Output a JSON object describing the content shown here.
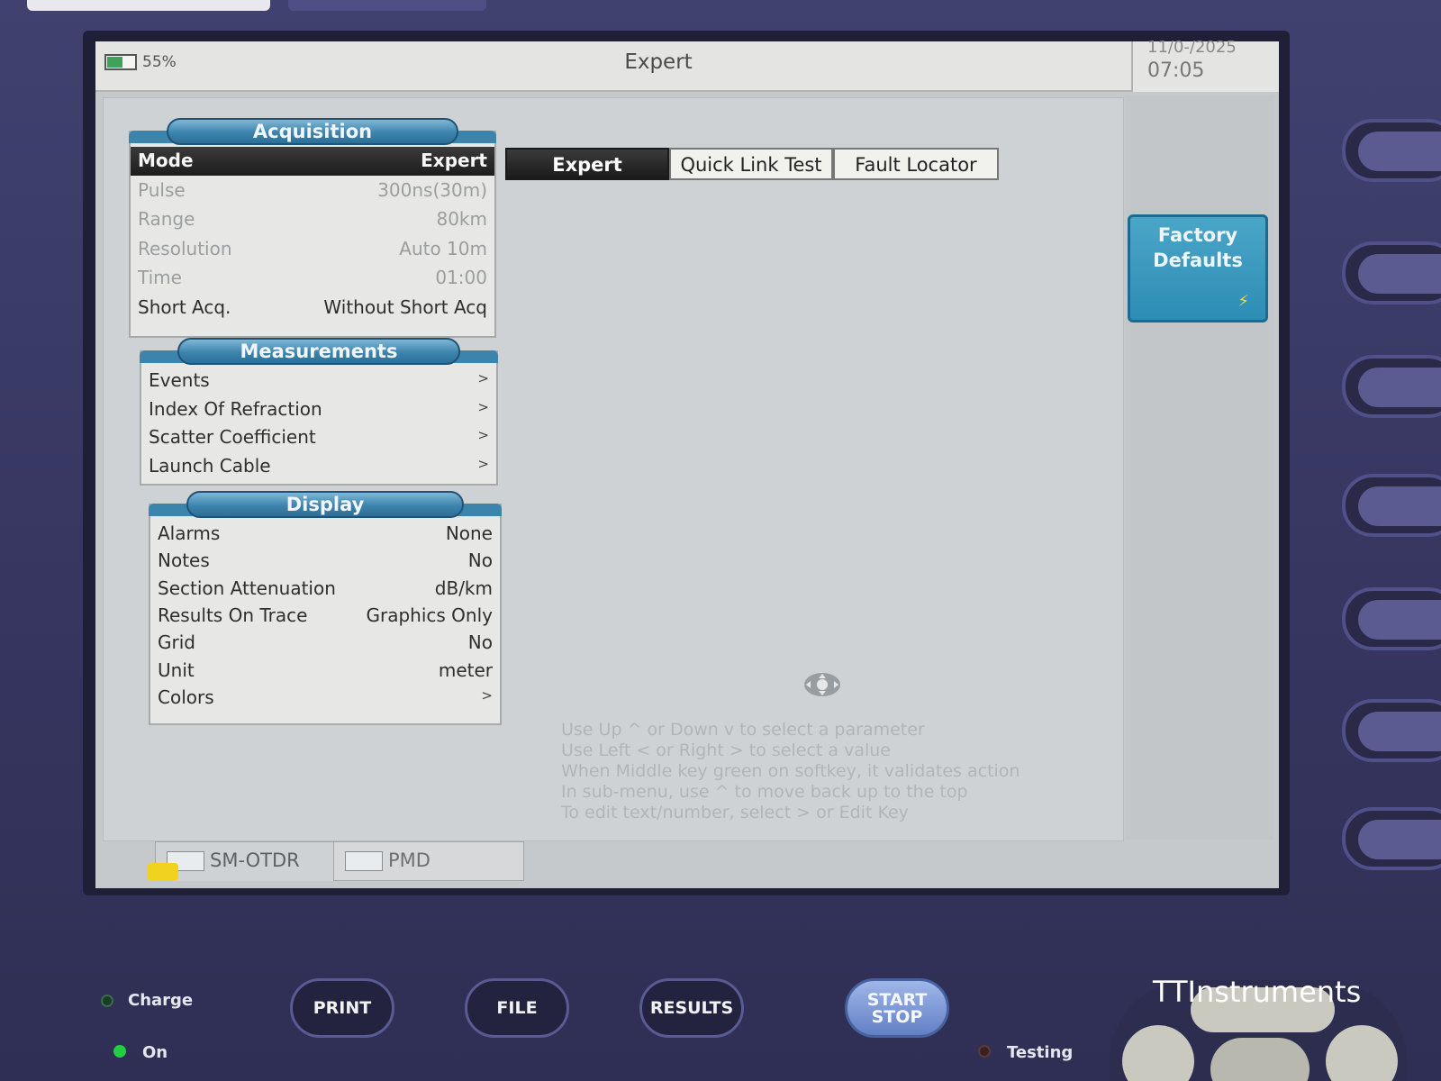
{
  "status_bar": {
    "battery_pct": "55%",
    "battery_level": 0.55,
    "title": "Expert",
    "date": "11/0-/2025",
    "time": "07:05"
  },
  "acquisition": {
    "header": "Acquisition",
    "rows": [
      {
        "label": "Mode",
        "value": "Expert",
        "state": "selected"
      },
      {
        "label": "Pulse",
        "value": "300ns(30m)",
        "state": "dim"
      },
      {
        "label": "Range",
        "value": "80km",
        "state": "dim"
      },
      {
        "label": "Resolution",
        "value": "Auto 10m",
        "state": "dim"
      },
      {
        "label": "Time",
        "value": "01:00",
        "state": "dim"
      },
      {
        "label": "Short Acq.",
        "value": "Without Short Acq",
        "state": "normal"
      }
    ]
  },
  "mode_options": [
    "Expert",
    "Quick Link Test",
    "Fault Locator"
  ],
  "measurements": {
    "header": "Measurements",
    "rows": [
      {
        "label": "Events",
        "value": ">"
      },
      {
        "label": "Index Of Refraction",
        "value": ">"
      },
      {
        "label": "Scatter Coefficient",
        "value": ">"
      },
      {
        "label": "Launch Cable",
        "value": ">"
      }
    ]
  },
  "display": {
    "header": "Display",
    "rows": [
      {
        "label": "Alarms",
        "value": "None"
      },
      {
        "label": "Notes",
        "value": "No"
      },
      {
        "label": "Section Attenuation",
        "value": "dB/km"
      },
      {
        "label": "Results On Trace",
        "value": "Graphics Only"
      },
      {
        "label": "Grid",
        "value": "No"
      },
      {
        "label": "Unit",
        "value": "meter"
      },
      {
        "label": "Colors",
        "value": ">"
      }
    ]
  },
  "help_lines": [
    "Use Up ^ or Down v to select a parameter",
    "Use Left < or Right > to select a value",
    "When Middle key green on softkey, it validates action",
    "In sub-menu, use ^ to move back up to the top",
    "To edit text/number, select > or Edit Key"
  ],
  "softkeys": {
    "factory_defaults_line1": "Factory",
    "factory_defaults_line2": "Defaults"
  },
  "bottom_tabs": [
    "SM-OTDR",
    "PMD"
  ],
  "hardware": {
    "print": "PRINT",
    "file": "FILE",
    "results": "RESULTS",
    "start_line1": "START",
    "start_line2": "STOP",
    "charge": "Charge",
    "on": "On",
    "testing": "Testing",
    "brand": "TTInstruments"
  },
  "colors": {
    "accent_header": "#3d84ad",
    "softkey_blue": "#2e8db5",
    "selected_row": "#1d1d1d",
    "led_green": "#22cc44"
  }
}
